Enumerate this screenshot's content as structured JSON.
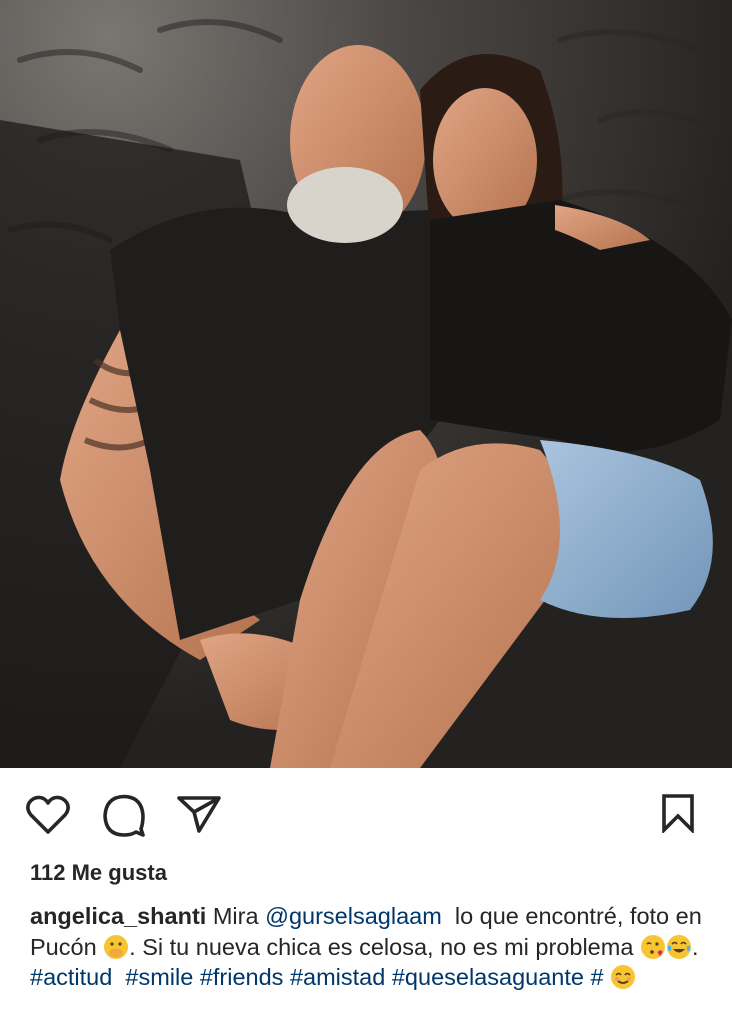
{
  "post": {
    "photo": {
      "alt": "",
      "colors": {
        "sand": "#3a3836",
        "shirt": "#1e1d1c",
        "skin": "#c98a68",
        "denim": "#8fb0cf",
        "beard": "#d8d4cc"
      }
    },
    "actions": {
      "like_icon": "heart-outline-icon",
      "comment_icon": "comment-bubble-icon",
      "share_icon": "paper-plane-icon",
      "save_icon": "bookmark-icon"
    },
    "likes_text": "112 Me gusta",
    "caption": {
      "username": "angelica_shanti",
      "line1_pre": "Mira",
      "mention": "@gurselsaglaam",
      "line1_post": "lo que",
      "line2_pre": "encontré, foto en Pucón",
      "line2_post": ". Si tu nueva chica es",
      "line3_pre": "celosa, no es mi problema",
      "line3_mid": ".",
      "hashtag_actitud": "#actitud",
      "hashtag_smile": "#smile",
      "hashtag_friends": "#friends",
      "hashtag_amistad": "#amistad",
      "hashtag_queselasaguante": "#queselasaguante",
      "hashtag_empty": "#",
      "emojis": {
        "shh": "face-with-hand-over-mouth-emoji",
        "kiss": "face-blowing-kiss-emoji",
        "laugh": "tears-of-joy-emoji",
        "smiling": "smiling-face-emoji"
      }
    }
  }
}
